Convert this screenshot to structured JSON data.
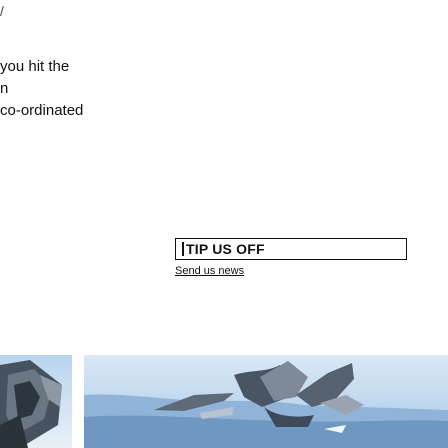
{
  "article": {
    "slash_mark": "/",
    "text_lines": [
      "you hit the",
      "n",
      "co-ordinated"
    ]
  },
  "tip_widget": {
    "title": "TIP US OFF",
    "link_label": "Send us news"
  },
  "images": {
    "left_thumb_icon": "photo-thumbnail",
    "right_thumb_icon": "photo-thumbnail"
  },
  "colors": {
    "text": "#111111",
    "sky_light": "#cfe3f4",
    "sky_mid": "#9fc4e6",
    "sky_dark": "#5f8fb8",
    "metal": "#8a95a0"
  }
}
